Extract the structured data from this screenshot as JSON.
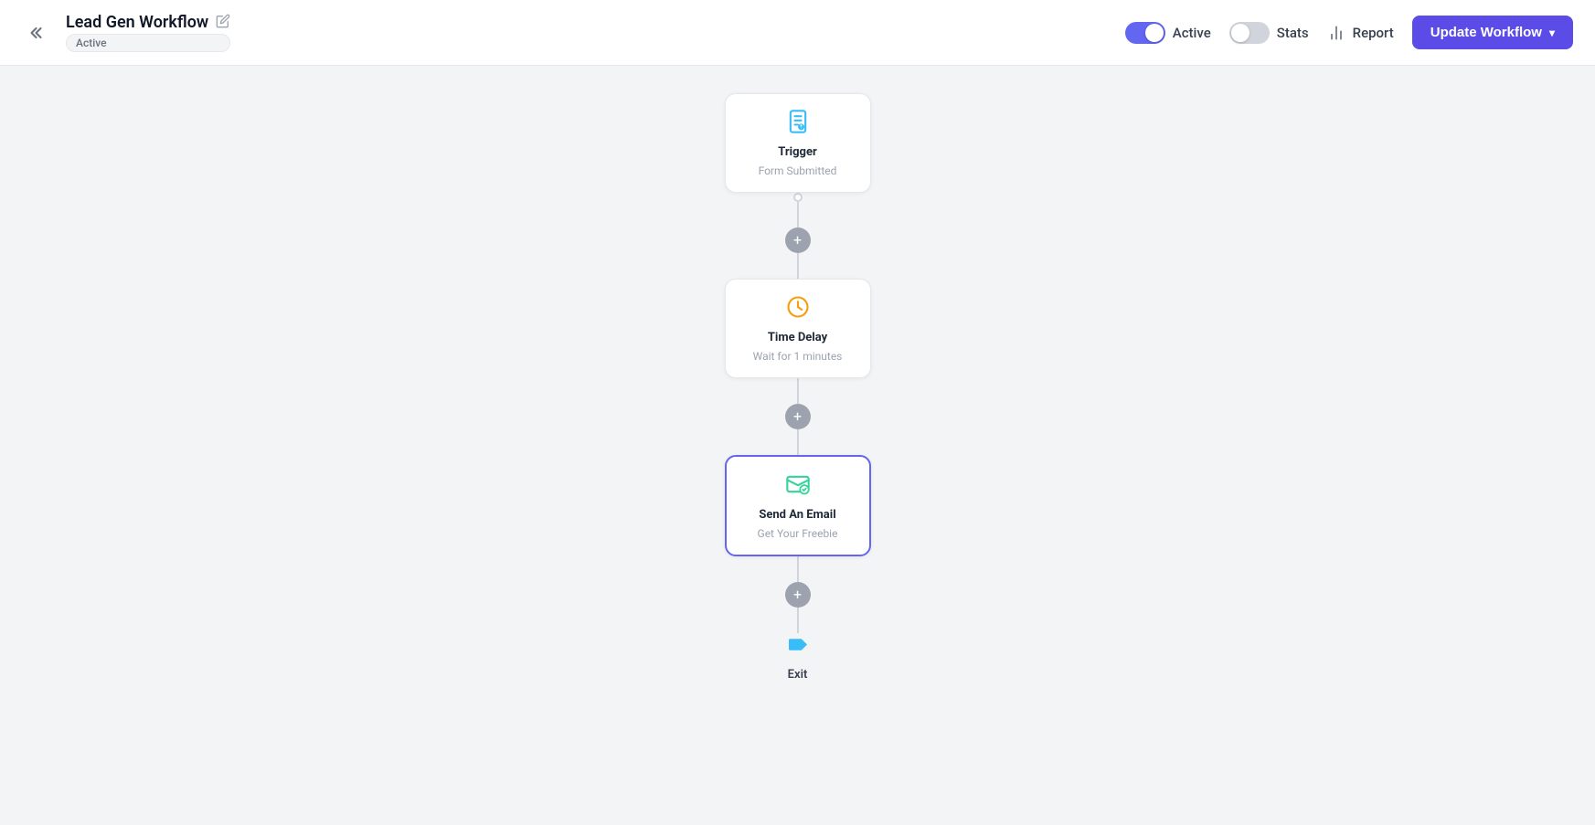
{
  "header": {
    "workflow_name": "Lead Gen Workflow",
    "status_badge": "Active",
    "active_toggle_label": "Active",
    "active_toggle_on": true,
    "stats_toggle_label": "Stats",
    "stats_toggle_on": false,
    "report_label": "Report",
    "update_btn_label": "Update Workflow"
  },
  "nodes": [
    {
      "id": "trigger",
      "type": "trigger",
      "title": "Trigger",
      "subtitle": "Form Submitted",
      "icon": "form",
      "selected": false
    },
    {
      "id": "time-delay",
      "type": "delay",
      "title": "Time Delay",
      "subtitle": "Wait for 1 minutes",
      "icon": "clock",
      "selected": false
    },
    {
      "id": "send-email",
      "type": "email",
      "title": "Send An Email",
      "subtitle": "Get Your Freebie",
      "icon": "email",
      "selected": true
    }
  ],
  "exit": {
    "label": "Exit",
    "icon": "flag"
  },
  "icons": {
    "back": "«",
    "edit": "✏",
    "add": "+",
    "chevron_down": "▾"
  }
}
